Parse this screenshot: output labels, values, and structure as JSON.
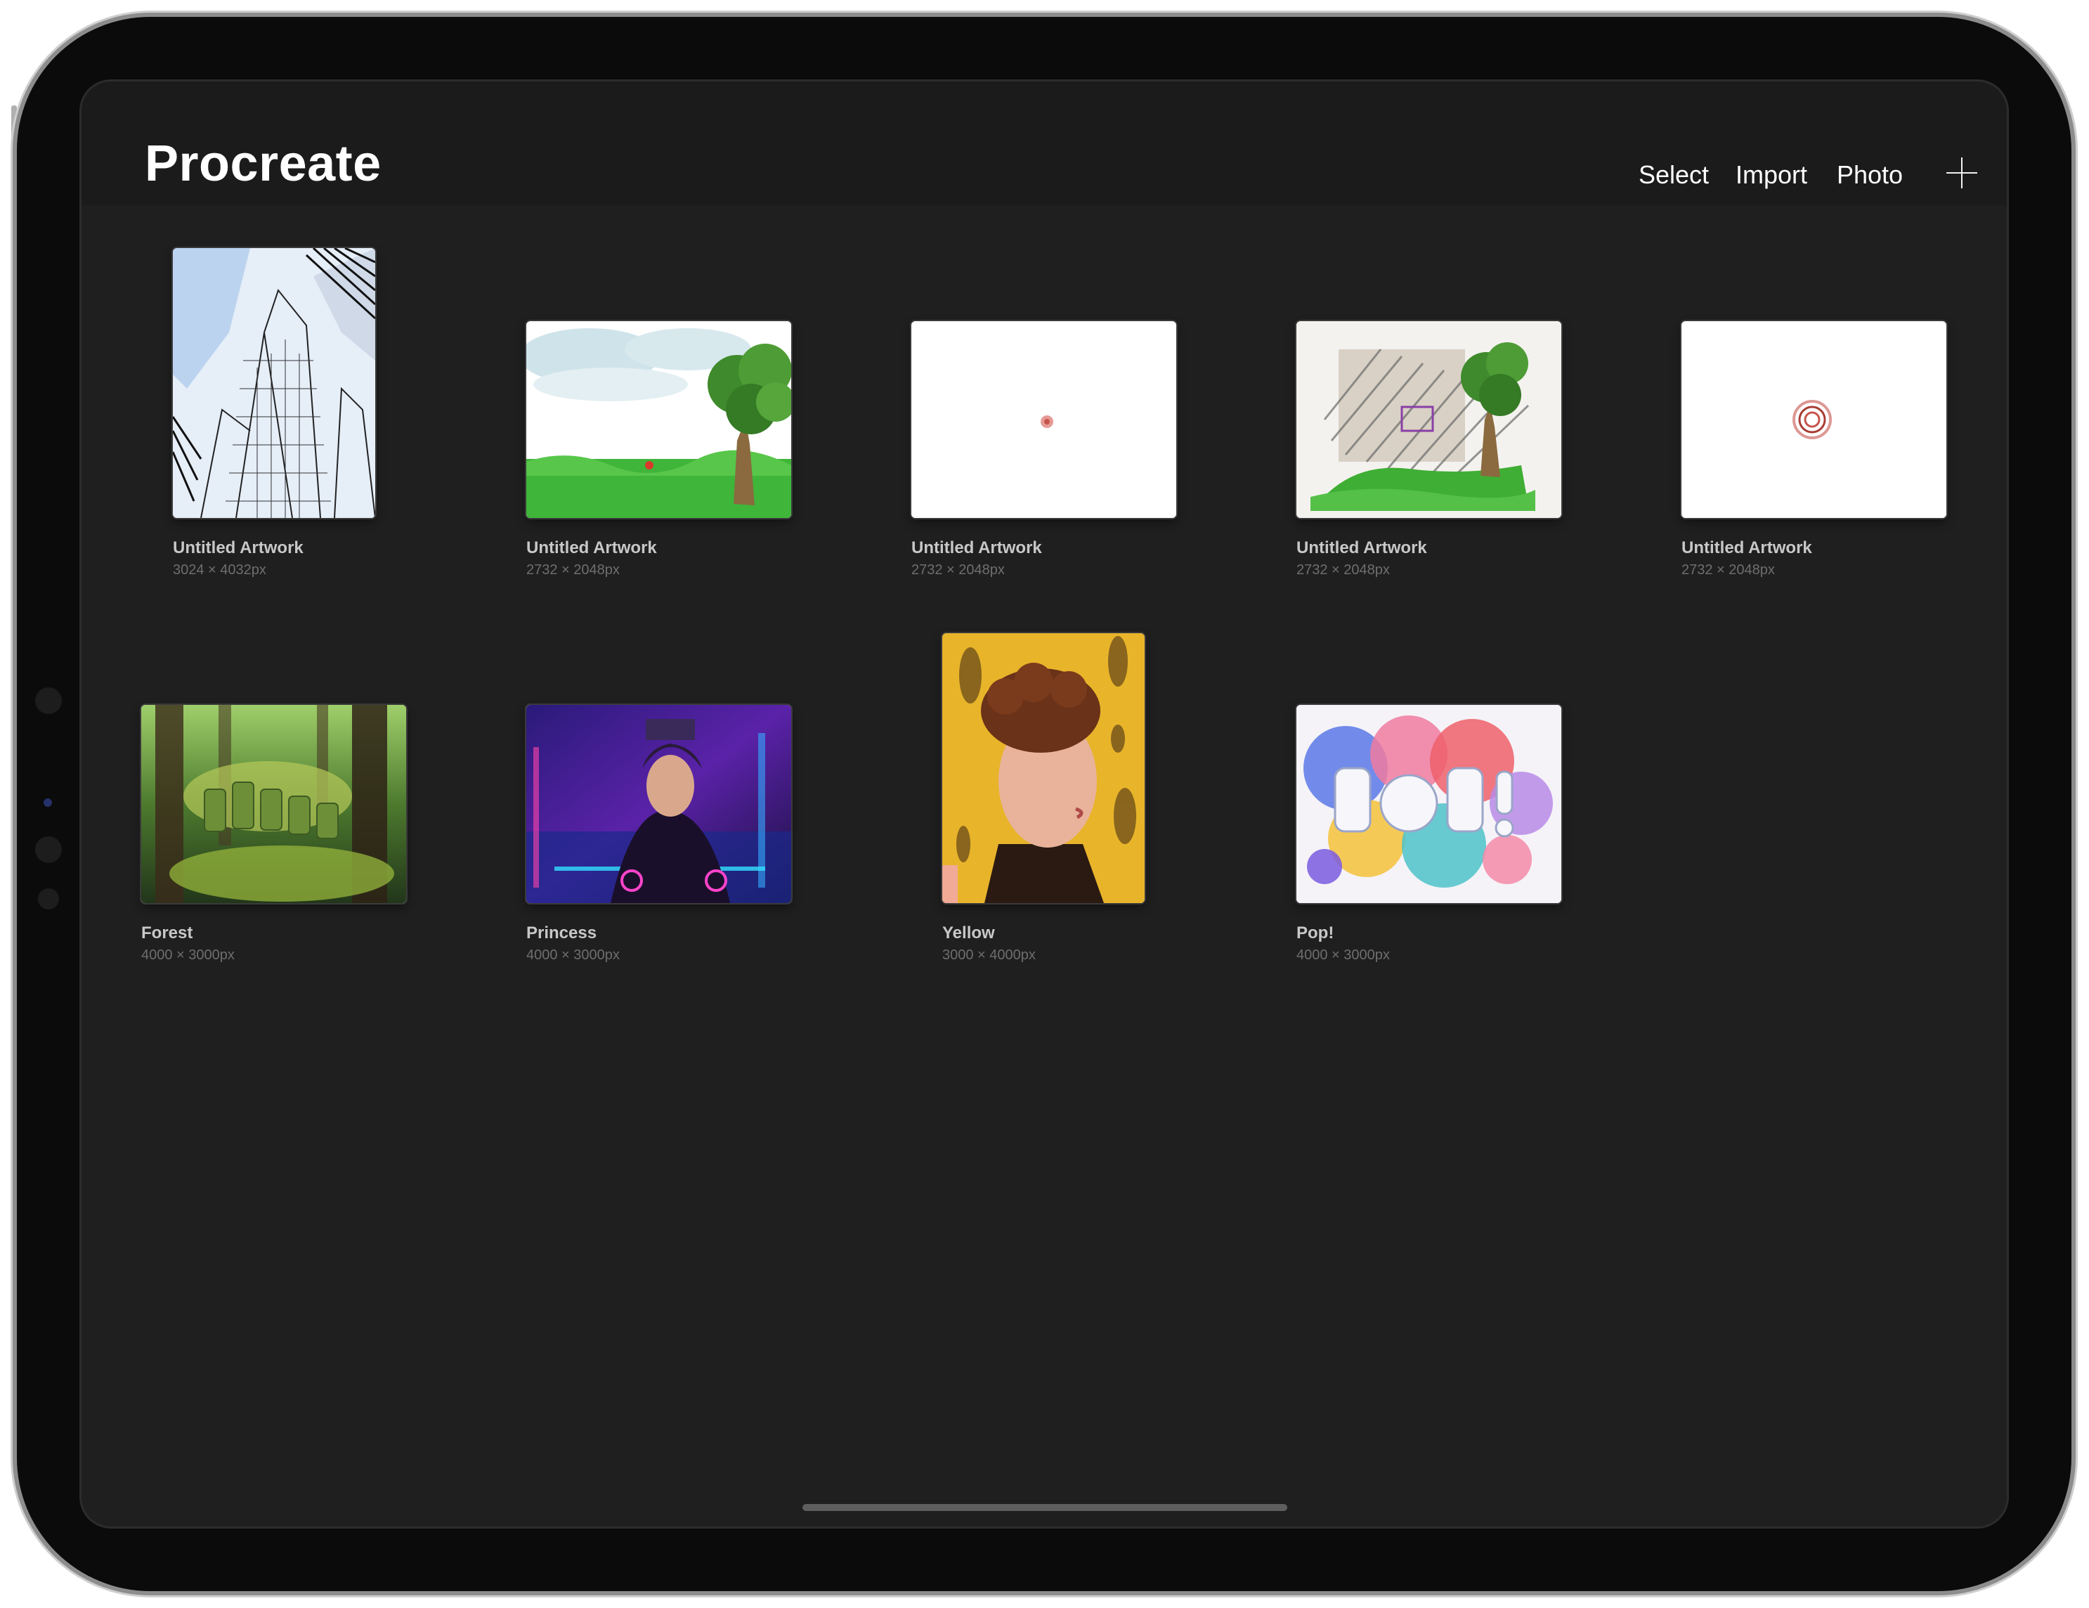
{
  "header": {
    "title": "Procreate",
    "select_label": "Select",
    "import_label": "Import",
    "photo_label": "Photo"
  },
  "gallery": {
    "artworks": [
      {
        "title": "Untitled Artwork",
        "size": "3024 × 4032px"
      },
      {
        "title": "Untitled Artwork",
        "size": "2732 × 2048px"
      },
      {
        "title": "Untitled Artwork",
        "size": "2732 × 2048px"
      },
      {
        "title": "Untitled Artwork",
        "size": "2732 × 2048px"
      },
      {
        "title": "Untitled Artwork",
        "size": "2732 × 2048px"
      },
      {
        "title": "Forest",
        "size": "4000 × 3000px"
      },
      {
        "title": "Princess",
        "size": "4000 × 3000px"
      },
      {
        "title": "Yellow",
        "size": "3000 × 4000px"
      },
      {
        "title": "Pop!",
        "size": "4000 × 3000px"
      }
    ]
  },
  "colors": {
    "background": "#1f1f1f",
    "topbar": "#1b1b1b",
    "title_text": "#ffffff",
    "artwork_title": "#c8c8c8",
    "artwork_size": "#6e6e6e"
  },
  "icons": {
    "new_canvas": "plus-icon"
  }
}
